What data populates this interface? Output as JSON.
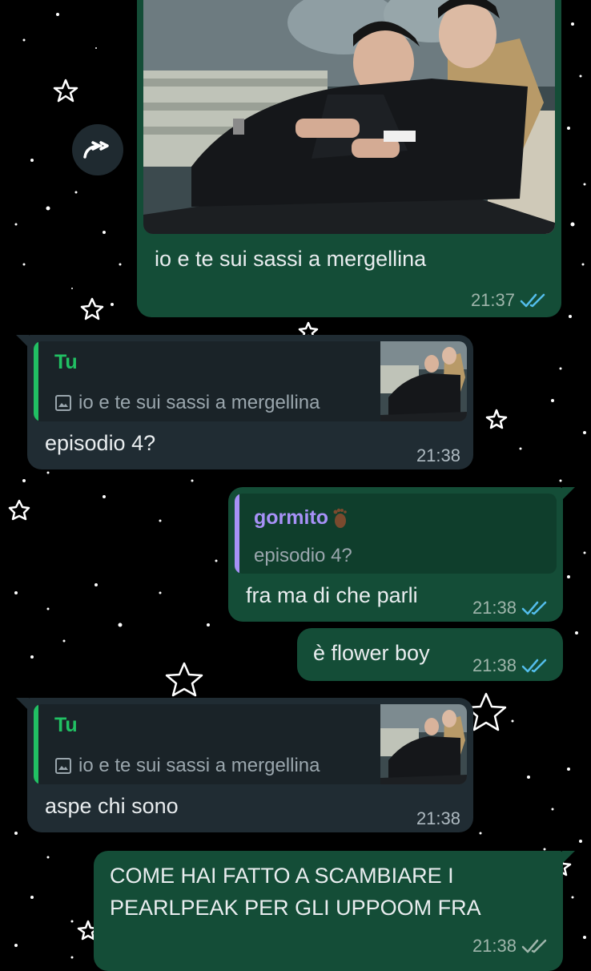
{
  "colors": {
    "background": "#000000",
    "outgoing_bubble": "#144d37",
    "incoming_bubble": "#202c33",
    "read_ticks": "#53bdeb",
    "quote_self": "#21c063",
    "quote_contact": "#a791f7"
  },
  "forward_button": {
    "icon": "forward-arrow-icon"
  },
  "messages": [
    {
      "direction": "outgoing",
      "has_photo": true,
      "text": "io e te sui sassi a mergellina",
      "time": "21:37",
      "status": "read"
    },
    {
      "direction": "incoming",
      "reply": {
        "author": "Tu",
        "icon": "image-icon",
        "text": "io e te sui sassi a mergellina",
        "thumbnail": true
      },
      "text": "episodio 4?",
      "time": "21:38"
    },
    {
      "direction": "outgoing",
      "reply": {
        "author": "gormito",
        "author_emoji": "foot-emoji",
        "text": "episodio 4?"
      },
      "text": "fra ma di che parli",
      "time": "21:38",
      "status": "read"
    },
    {
      "direction": "outgoing",
      "text": "è flower boy",
      "time": "21:38",
      "status": "read"
    },
    {
      "direction": "incoming",
      "reply": {
        "author": "Tu",
        "icon": "image-icon",
        "text": "io e te sui sassi a mergellina",
        "thumbnail": true
      },
      "text": "aspe chi sono",
      "time": "21:38"
    },
    {
      "direction": "outgoing",
      "text_lines": [
        "COME HAI FATTO A SCAMBIARE I",
        "PEARLPEAK PER GLI UPPOOM FRA"
      ],
      "time": "21:38",
      "status": "delivered"
    }
  ]
}
